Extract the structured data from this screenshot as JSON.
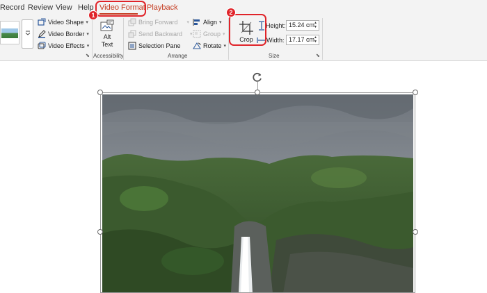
{
  "tabs": [
    {
      "label": "Record"
    },
    {
      "label": "Review"
    },
    {
      "label": "View"
    },
    {
      "label": "Help"
    },
    {
      "label": "Video Format"
    },
    {
      "label": "Playback"
    }
  ],
  "active_tab": "Video Format",
  "ribbon": {
    "styles": {
      "video_shape": "Video Shape",
      "video_border": "Video Border",
      "video_effects": "Video Effects"
    },
    "accessibility": {
      "alt_text_line1": "Alt",
      "alt_text_line2": "Text",
      "group_label": "Accessibility"
    },
    "arrange": {
      "bring_forward": "Bring Forward",
      "send_backward": "Send Backward",
      "selection_pane": "Selection Pane",
      "align": "Align",
      "group": "Group",
      "rotate": "Rotate",
      "group_label": "Arrange"
    },
    "size": {
      "crop": "Crop",
      "height_label": "Height:",
      "height_value": "15.24 cm",
      "width_label": "Width:",
      "width_value": "17.17 cm",
      "group_label": "Size"
    }
  },
  "annotations": [
    {
      "number": "1"
    },
    {
      "number": "2"
    }
  ],
  "colors": {
    "accent_red": "#c4391d",
    "callout_red": "#e0242a",
    "ribbon_bg": "#f3f3f3"
  }
}
